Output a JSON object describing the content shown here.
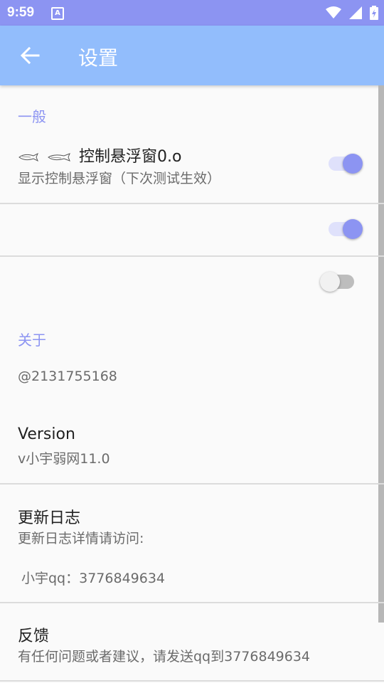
{
  "status_bar": {
    "time": "9:59",
    "notification_icon": "a-icon"
  },
  "app_bar": {
    "title": "设置",
    "back_icon": "arrow-left-icon"
  },
  "general": {
    "category": "一般",
    "float_window": {
      "title": "控制悬浮窗0.o",
      "summary": "显示控制悬浮窗（下次测试生效）",
      "enabled": true
    },
    "second_switch_enabled": true,
    "third_switch_enabled": false
  },
  "about": {
    "category": "关于",
    "contact": "@2131755168",
    "version": {
      "title": "Version",
      "summary": "v小宇弱网11.0"
    },
    "changelog": {
      "title": "更新日志",
      "summary": "更新日志详情请访问:",
      "qq": "小宇qq：3776849634"
    },
    "feedback": {
      "title": "反馈",
      "summary": "有任何问题或者建议，请发送qq到3776849634"
    }
  },
  "colors": {
    "accent": "#8c94f2",
    "app_bar": "#92bdfc",
    "status_bar": "#8c94f2"
  }
}
